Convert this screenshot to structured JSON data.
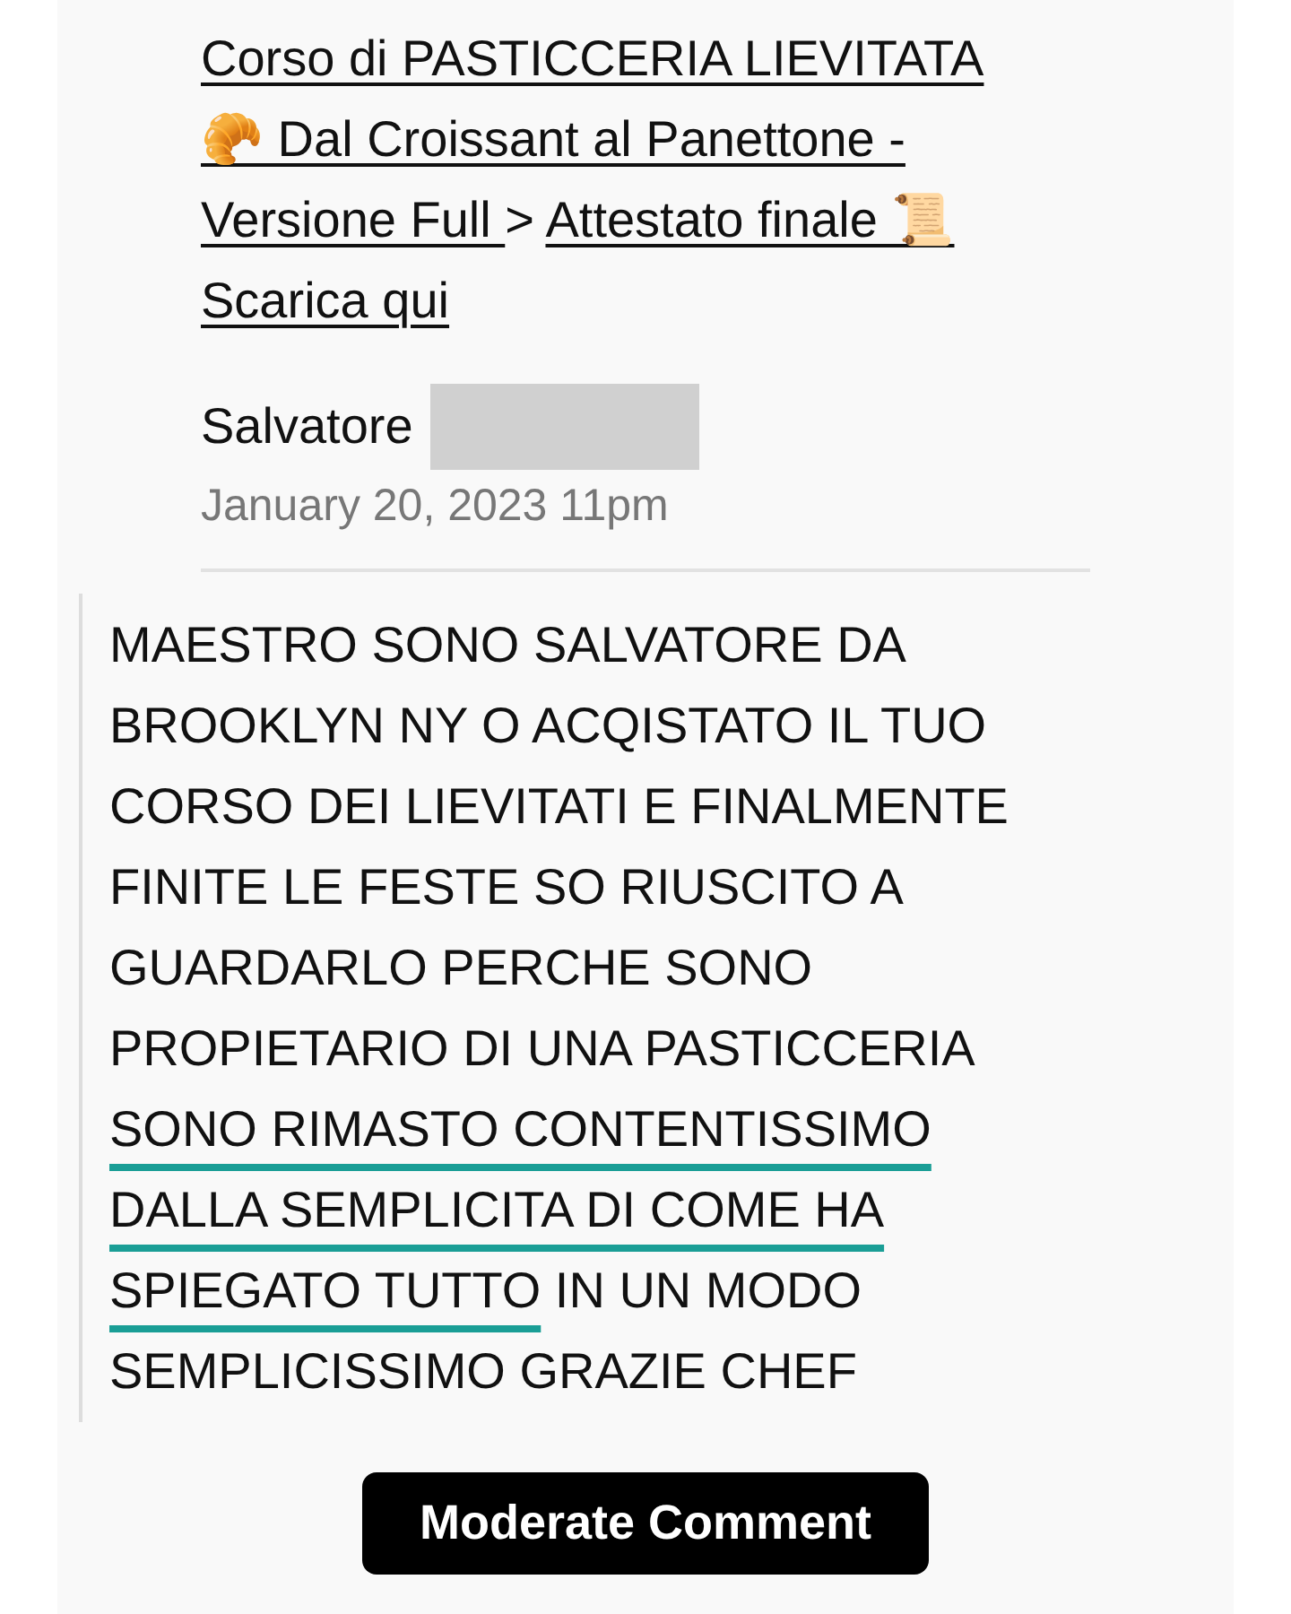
{
  "breadcrumb": {
    "course_link": "Corso di PASTICCERIA LIEVITATA 🥐 Dal Croissant al Panettone - Versione Full ",
    "separator": ">",
    "lesson_link": "Attestato finale 📜 Scarica qui"
  },
  "comment": {
    "author": "Salvatore",
    "author_redacted": true,
    "date": "January 20, 2023 11pm",
    "segments": [
      {
        "text": "MAESTRO SONO SALVATORE DA BROOKLYN NY O ACQISTATO IL TUO CORSO DEI LIEVITATI E FINALMENTE FINITE LE FESTE SO RIUSCITO A GUARDARLO PERCHE SONO PROPIETARIO DI UNA PASTICCERIA ",
        "highlighted": false
      },
      {
        "text": "SONO RIMASTO CONTENTISSIMO DALLA SEMPLICITA DI COME HA SPIEGATO TUTTO",
        "highlighted": true
      },
      {
        "text": " IN UN MODO SEMPLICISSIMO GRAZIE CHEF",
        "highlighted": false
      }
    ]
  },
  "moderate_button": "Moderate Comment"
}
